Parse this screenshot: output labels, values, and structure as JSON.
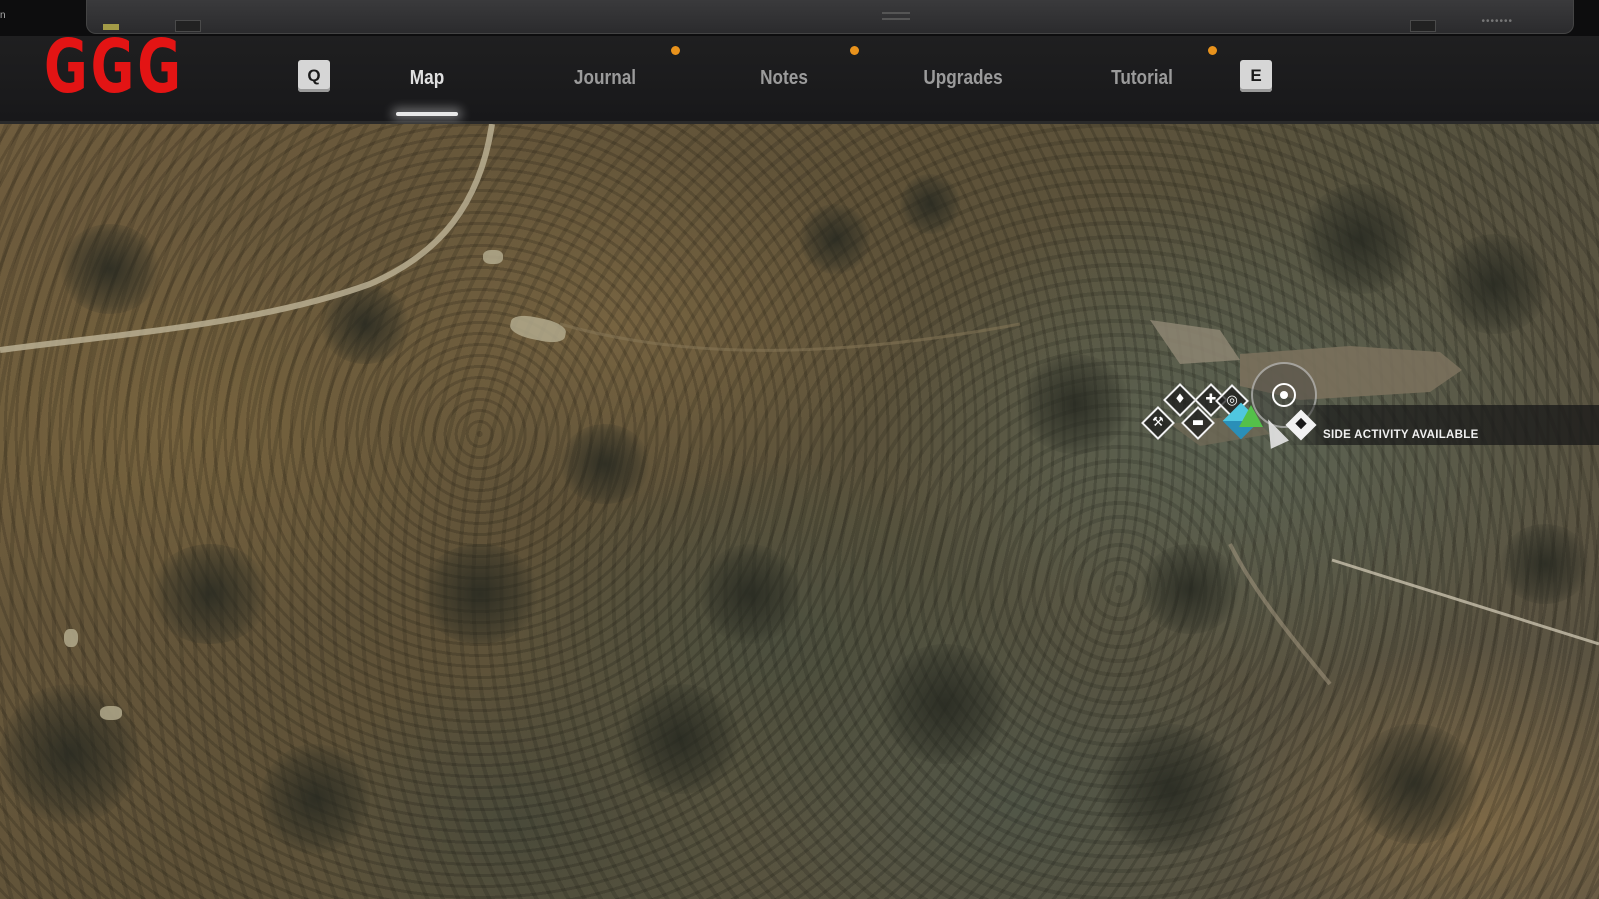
{
  "window": {
    "corner_char": "n",
    "chrome_dots": "•••••••"
  },
  "header": {
    "logo": "GGG",
    "prev_key": "Q",
    "next_key": "E",
    "tabs": [
      {
        "label": "Map",
        "active": true,
        "has_notification": false
      },
      {
        "label": "Journal",
        "active": false,
        "has_notification": true
      },
      {
        "label": "Notes",
        "active": false,
        "has_notification": true
      },
      {
        "label": "Upgrades",
        "active": false,
        "has_notification": false
      },
      {
        "label": "Tutorial",
        "active": false,
        "has_notification": true
      }
    ],
    "notification_color": "#e8921c",
    "logo_color": "#e31414"
  },
  "map": {
    "tooltip": "SIDE ACTIVITY AVAILABLE",
    "markers": [
      {
        "icon": "tool-marker-icon",
        "glyph": "⚒"
      },
      {
        "icon": "loot-marker-icon",
        "glyph": "♦"
      },
      {
        "icon": "bed-marker-icon",
        "glyph": "▬"
      },
      {
        "icon": "medical-marker-icon",
        "glyph": "✚"
      },
      {
        "icon": "target-marker-icon",
        "glyph": "◎"
      }
    ],
    "colors": {
      "objective_blue": "#4fc7e0",
      "objective_green": "#54c04a"
    }
  }
}
